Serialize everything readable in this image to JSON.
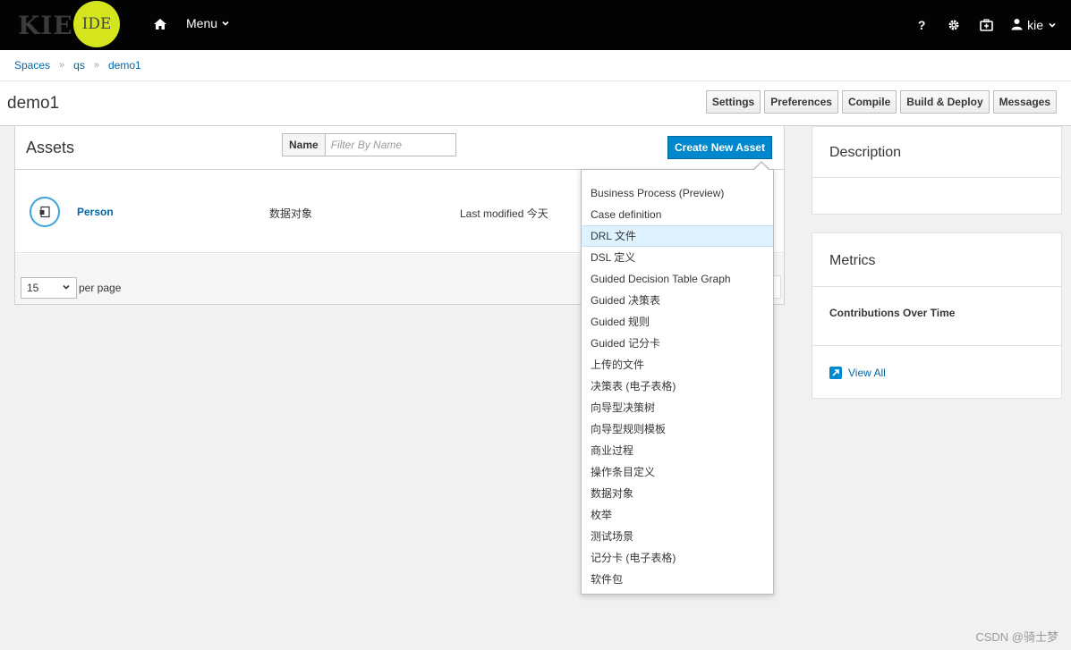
{
  "navbar": {
    "logo_kie": "KIE",
    "logo_ide": "IDE",
    "menu_label": "Menu",
    "help_label": "?",
    "user_label": "kie"
  },
  "breadcrumb": [
    "Spaces",
    "qs",
    "demo1"
  ],
  "page": {
    "title": "demo1",
    "toolbar": [
      "Settings",
      "Preferences",
      "Compile",
      "Build & Deploy",
      "Messages"
    ]
  },
  "assets": {
    "title": "Assets",
    "filter_label": "Name",
    "filter_placeholder": "Filter By Name",
    "create_button": "Create New Asset",
    "items": [
      {
        "name": "Person",
        "type": "数据对象",
        "modified": "Last modified 今天"
      }
    ],
    "per_page_value": "15",
    "per_page_label": "per page"
  },
  "create_menu": {
    "active_index": 2,
    "items": [
      "Business Process (Preview)",
      "Case definition",
      "DRL 文件",
      "DSL 定义",
      "Guided Decision Table Graph",
      "Guided 决策表",
      "Guided 规则",
      "Guided 记分卡",
      "上传的文件",
      "决策表 (电子表格)",
      "向导型决策树",
      "向导型规则模板",
      "商业过程",
      "操作条目定义",
      "数据对象",
      "枚举",
      "测试场景",
      "记分卡 (电子表格)",
      "软件包"
    ]
  },
  "sidebar": {
    "description_title": "Description",
    "metrics_title": "Metrics",
    "contributions_label": "Contributions Over Time",
    "view_all_label": "View All"
  },
  "watermark": "CSDN @骑士梦",
  "colors": {
    "navbar_bg": "#030303",
    "ide_logo": "#d5e51d",
    "primary_button": "#0088ce",
    "link": "#0066a5",
    "menu_active": "#def3ff"
  }
}
